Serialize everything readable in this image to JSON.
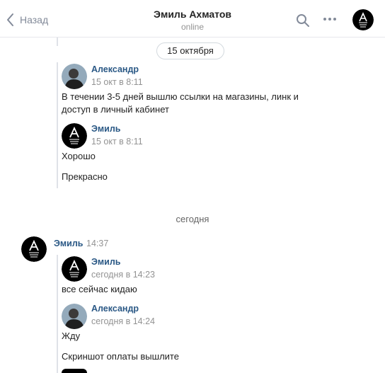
{
  "header": {
    "back_label": "Назад",
    "title": "Эмиль Ахматов",
    "status": "online"
  },
  "date_pill": "15 октября",
  "forwarded_block_1": {
    "messages": [
      {
        "author": "Александр",
        "time": "15 окт в 8:11",
        "lines": [
          "В течении 3-5 дней вышлю ссылки на магазины, линк и",
          "доступ в личный кабинет"
        ]
      },
      {
        "author": "Эмиль",
        "time": "15 окт в 8:11",
        "lines": [
          "Хорошо",
          "Прекрасно"
        ]
      }
    ]
  },
  "today_divider": "сегодня",
  "message": {
    "author": "Эмиль",
    "time": "14:37",
    "forwarded": [
      {
        "author": "Эмиль",
        "time": "сегодня в 14:23",
        "lines": [
          "все сейчас кидаю"
        ]
      },
      {
        "author": "Александр",
        "time": "сегодня в 14:24",
        "lines": [
          "Жду",
          "Скриншот оплаты вышлите"
        ]
      }
    ]
  },
  "colors": {
    "link": "#2a5885",
    "muted": "#939393",
    "line": "#dfe2e8"
  }
}
